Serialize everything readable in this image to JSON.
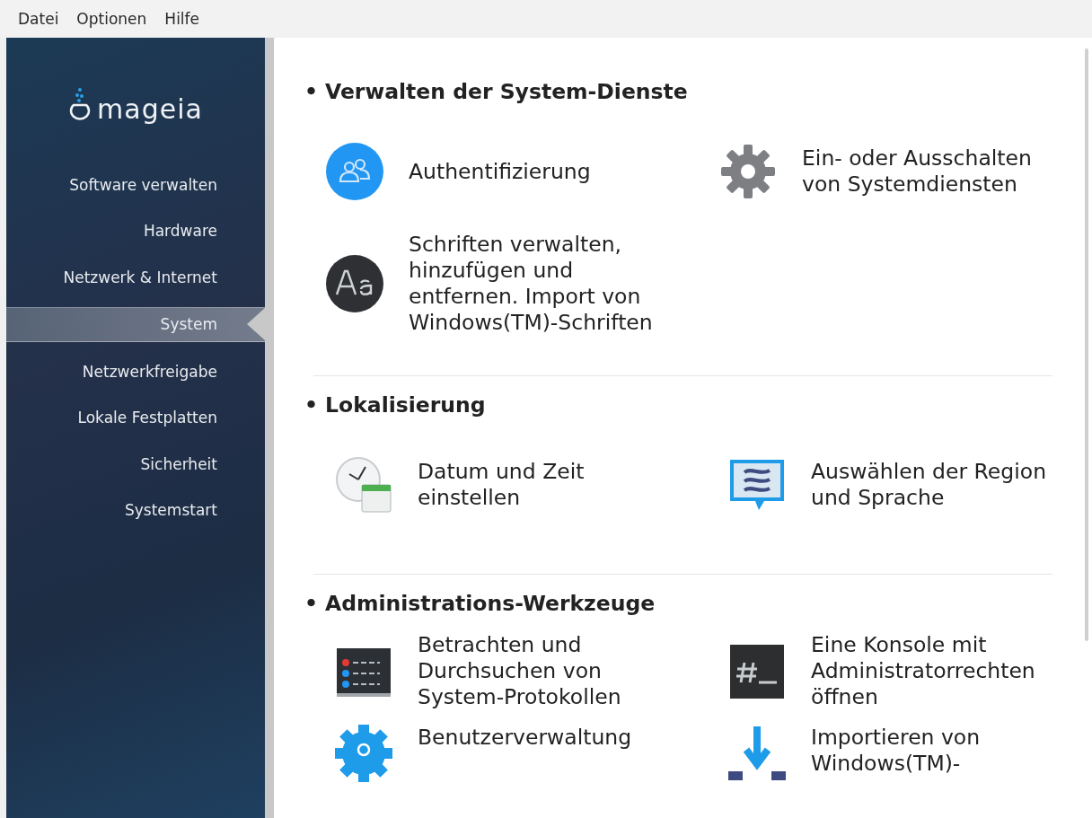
{
  "menu_bar": {
    "items": [
      "Datei",
      "Optionen",
      "Hilfe"
    ]
  },
  "sidebar": {
    "logo_text": "mageia",
    "items": [
      {
        "label": "Software verwalten",
        "selected": false
      },
      {
        "label": "Hardware",
        "selected": false
      },
      {
        "label": "Netzwerk & Internet",
        "selected": false
      },
      {
        "label": "System",
        "selected": true
      },
      {
        "label": "Netzwerkfreigabe",
        "selected": false
      },
      {
        "label": "Lokale Festplatten",
        "selected": false
      },
      {
        "label": "Sicherheit",
        "selected": false
      },
      {
        "label": "Systemstart",
        "selected": false
      }
    ]
  },
  "sections": [
    {
      "title": "Verwalten der System-Dienste",
      "bullet": "•",
      "items": [
        {
          "kind": "users",
          "label": "Authentifizierung"
        },
        {
          "kind": "gear",
          "label": "Ein- oder Ausschalten von Systemdiensten"
        },
        {
          "kind": "fonts",
          "label": "Schriften verwalten, hinzufügen und entfernen. Import von Windows(TM)-Schriften"
        }
      ]
    },
    {
      "title": "Lokalisierung",
      "bullet": "•",
      "items": [
        {
          "kind": "clock",
          "label": "Datum und Zeit einstellen"
        },
        {
          "kind": "speech",
          "label": "Auswählen der Region und Sprache"
        }
      ]
    },
    {
      "title": "Administrations-Werkzeuge",
      "bullet": "•",
      "items": [
        {
          "kind": "logs",
          "label": "Betrachten und Durchsuchen von System-Protokollen"
        },
        {
          "kind": "console",
          "label": "Eine Konsole mit Administratorrechten öffnen"
        },
        {
          "kind": "usergear",
          "label": "Benutzerverwaltung"
        },
        {
          "kind": "import",
          "label": "Importieren von Windows(TM)-"
        }
      ]
    }
  ]
}
